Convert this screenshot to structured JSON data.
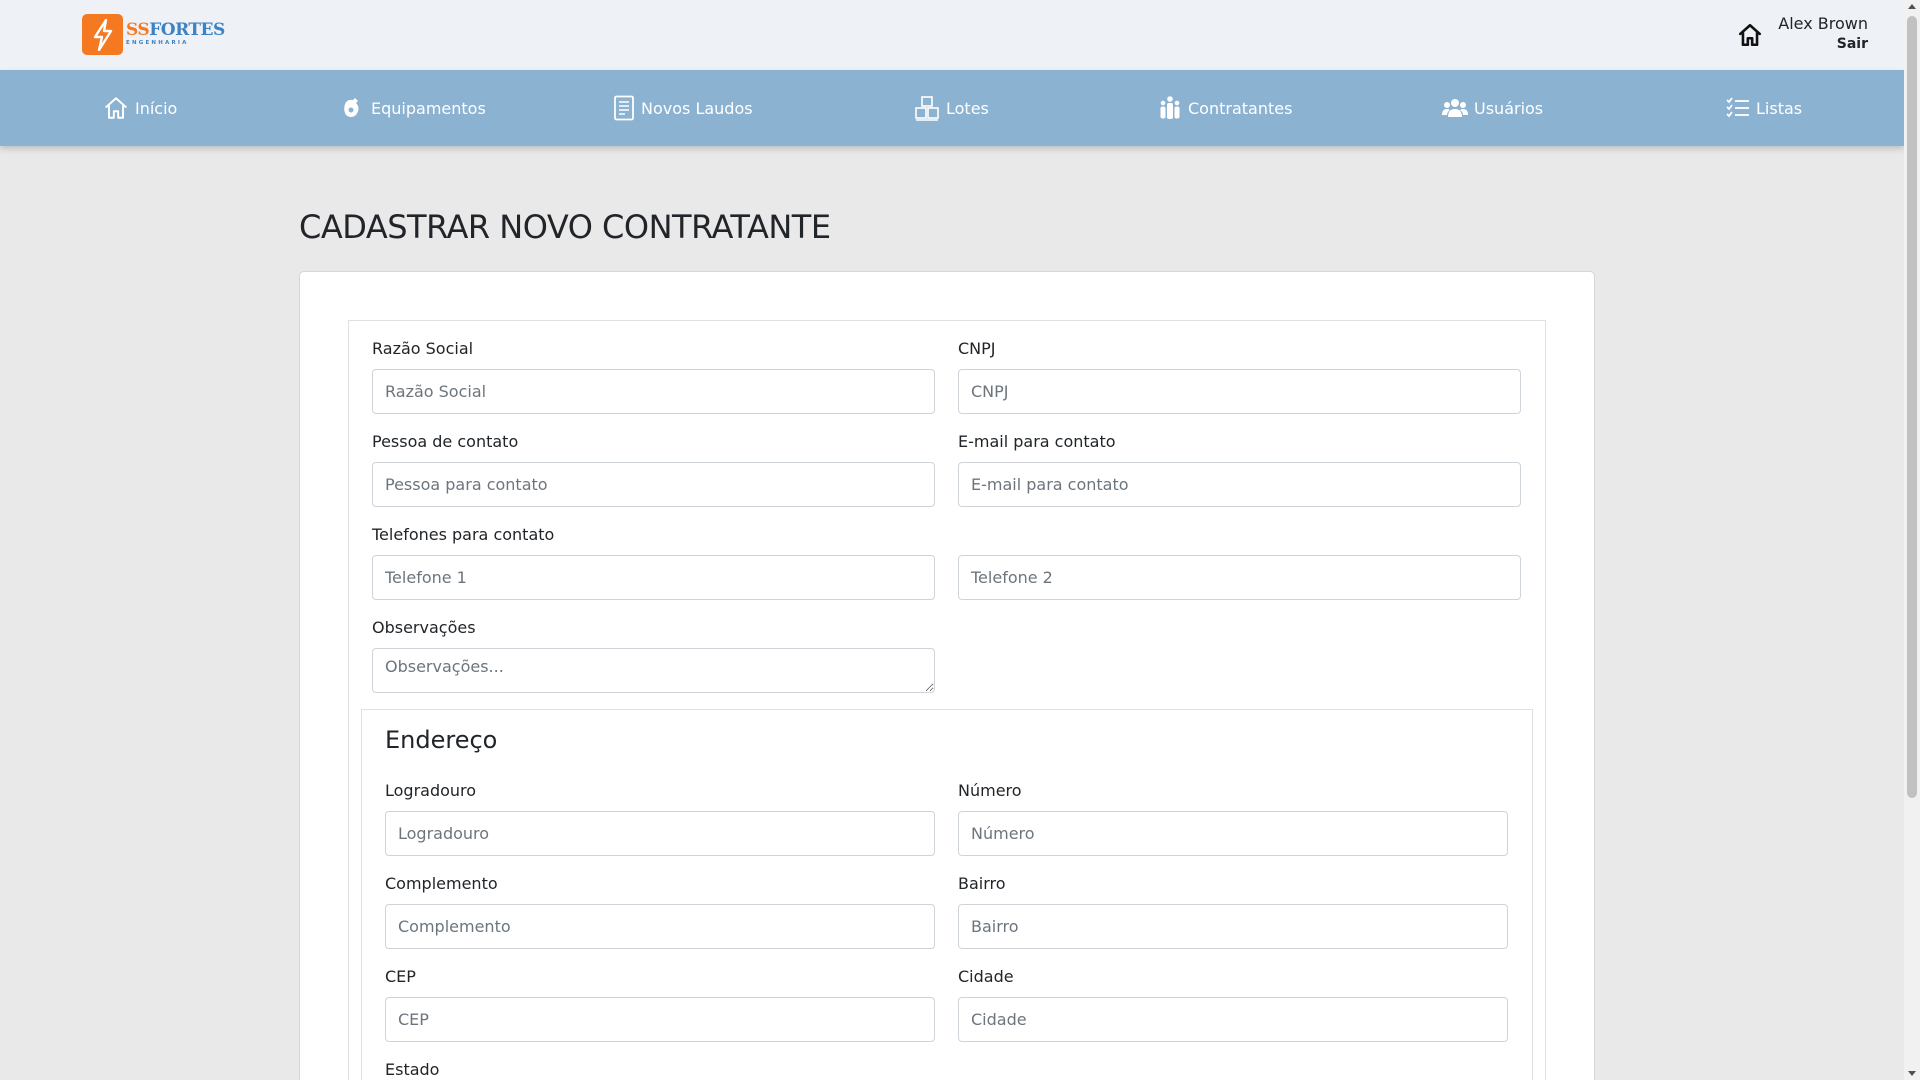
{
  "brand": {
    "name_part1": "SS",
    "name_part2": "FORTES",
    "subtitle": "ENGENHARIA",
    "icon": "lightning-bolt-icon",
    "colors": {
      "orange": "#f47920",
      "blue": "#3d82c4"
    }
  },
  "header": {
    "home_icon": "home-icon",
    "user_name": "Alex Brown",
    "logout_label": "Sair"
  },
  "nav": {
    "background": "#8cb2d2",
    "items": [
      {
        "label": "Início",
        "icon": "home-outline-icon"
      },
      {
        "label": "Equipamentos",
        "icon": "equipment-icon"
      },
      {
        "label": "Novos Laudos",
        "icon": "report-icon"
      },
      {
        "label": "Lotes",
        "icon": "boxes-icon"
      },
      {
        "label": "Contratantes",
        "icon": "people-group-icon"
      },
      {
        "label": "Usuários",
        "icon": "users-icon"
      },
      {
        "label": "Listas",
        "icon": "checklist-icon"
      }
    ]
  },
  "page": {
    "title": "CADASTRAR NOVO CONTRATANTE"
  },
  "form": {
    "razao_social": {
      "label": "Razão Social",
      "placeholder": "Razão Social",
      "value": ""
    },
    "cnpj": {
      "label": "CNPJ",
      "placeholder": "CNPJ",
      "value": ""
    },
    "pessoa_contato": {
      "label": "Pessoa de contato",
      "placeholder": "Pessoa para contato",
      "value": ""
    },
    "email_contato": {
      "label": "E-mail para contato",
      "placeholder": "E-mail para contato",
      "value": ""
    },
    "telefones": {
      "label": "Telefones para contato",
      "placeholder1": "Telefone 1",
      "placeholder2": "Telefone 2"
    },
    "observacoes": {
      "label": "Observações",
      "placeholder": "Observações..."
    }
  },
  "address": {
    "title": "Endereço",
    "logradouro": {
      "label": "Logradouro",
      "placeholder": "Logradouro"
    },
    "numero": {
      "label": "Número",
      "placeholder": "Número"
    },
    "complemento": {
      "label": "Complemento",
      "placeholder": "Complemento"
    },
    "bairro": {
      "label": "Bairro",
      "placeholder": "Bairro"
    },
    "cep": {
      "label": "CEP",
      "placeholder": "CEP"
    },
    "cidade": {
      "label": "Cidade",
      "placeholder": "Cidade"
    },
    "estado": {
      "label": "Estado"
    }
  }
}
